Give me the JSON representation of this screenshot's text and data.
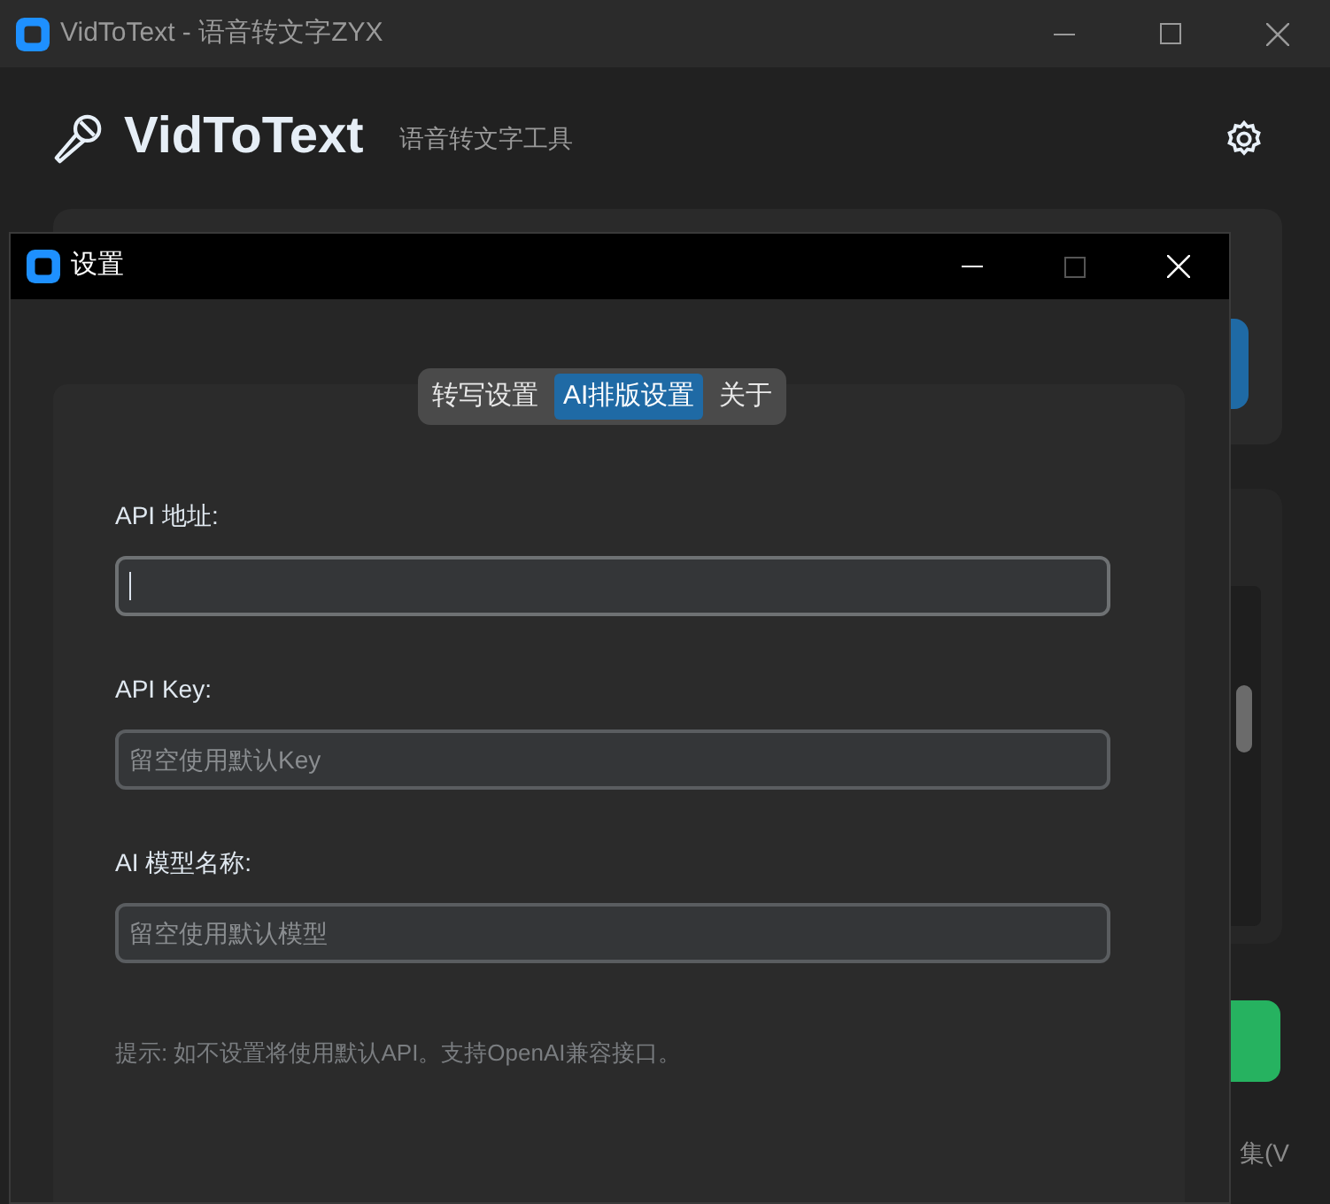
{
  "window": {
    "title": "VidToText - 语音转文字ZYX"
  },
  "header": {
    "app_name": "VidToText",
    "subtitle": "语音转文字工具"
  },
  "background": {
    "footer_text": "集(V"
  },
  "dialog": {
    "title": "设置",
    "tabs": [
      {
        "label": "转写设置",
        "selected": false
      },
      {
        "label": "AI排版设置",
        "selected": true
      },
      {
        "label": "关于",
        "selected": false
      }
    ],
    "fields": [
      {
        "label": "API 地址:",
        "focused": true
      },
      {
        "label": "API Key:",
        "placeholder": "留空使用默认Key",
        "focused": false
      },
      {
        "label": "AI 模型名称:",
        "placeholder": "留空使用默认模型",
        "focused": false
      }
    ],
    "hint": "提示: 如不设置将使用默认API。支持OpenAI兼容接口。"
  }
}
